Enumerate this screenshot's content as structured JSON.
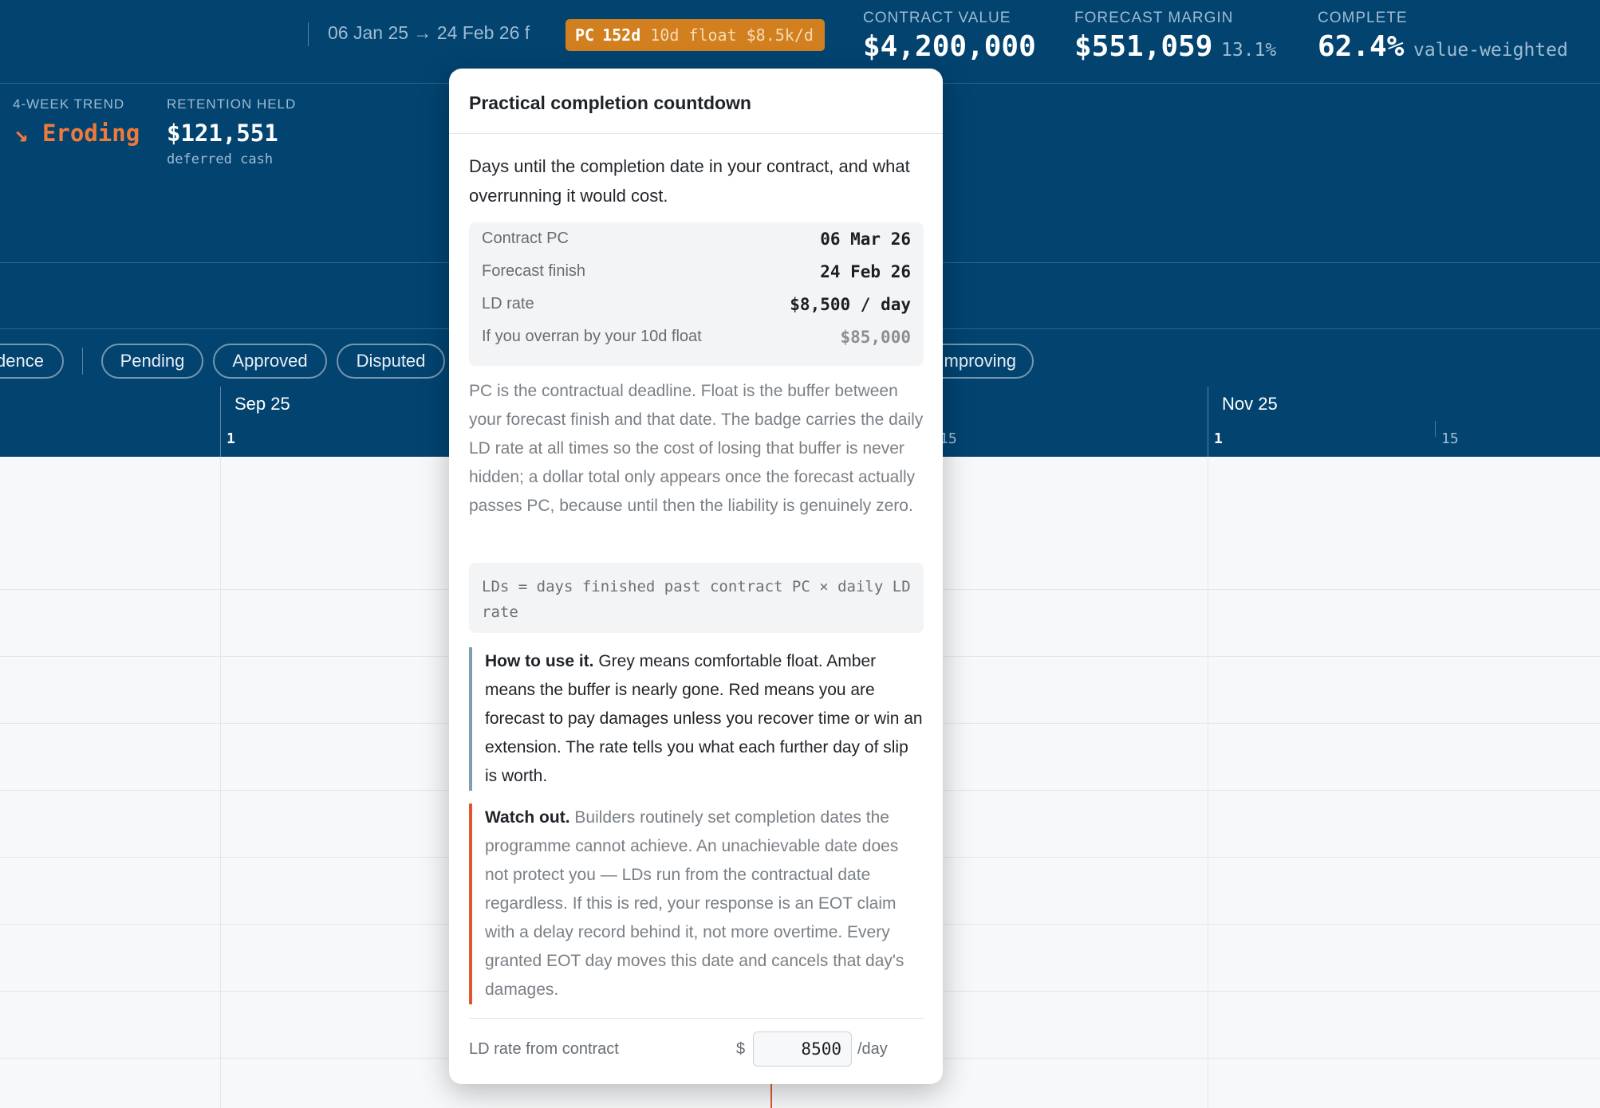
{
  "header": {
    "date_range": "06 Jan 25 → 24 Feb 26 f",
    "pc_badge": {
      "label": "PC",
      "days": "152d",
      "float": "10d float",
      "rate": "$8.5k/d"
    },
    "kpis": [
      {
        "label": "CONTRACT VALUE",
        "value": "$4,200,000",
        "sub": ""
      },
      {
        "label": "FORECAST MARGIN",
        "value": "$551,059",
        "sub": "13.1%"
      },
      {
        "label": "COMPLETE",
        "value": "62.4%",
        "sub": "value-weighted"
      }
    ],
    "trend": {
      "label": "4-WEEK TREND",
      "icon": "arrow-down-right-icon",
      "value": "Eroding"
    },
    "retention": {
      "label": "RETENTION HELD",
      "value": "$121,551",
      "sub": "deferred cash"
    },
    "filters": [
      "dence",
      "Pending",
      "Approved",
      "Disputed",
      "mproving"
    ],
    "timeline": {
      "months": [
        "Sep 25",
        "Nov 25"
      ],
      "ticks": [
        "1",
        "15",
        "1",
        "15"
      ]
    }
  },
  "popover": {
    "title": "Practical completion countdown",
    "intro": "Days until the completion date in your contract, and what overrunning it would cost.",
    "stats": [
      {
        "label": "Contract PC",
        "value": "06 Mar 26"
      },
      {
        "label": "Forecast finish",
        "value": "24 Feb 26"
      },
      {
        "label": "LD rate",
        "value": "$8,500 / day"
      },
      {
        "label": "If you overran by your 10d float",
        "value": "$85,000"
      }
    ],
    "explanation": "PC is the contractual deadline. Float is the buffer between your forecast finish and that date. The badge carries the daily LD rate at all times so the cost of losing that buffer is never hidden; a dollar total only appears once the forecast actually passes PC, because until then the liability is genuinely zero.",
    "formula": "LDs = days finished past contract PC × daily LD rate",
    "how_to": {
      "lead": "How to use it.",
      "text": " Grey means comfortable float. Amber means the buffer is nearly gone. Red means you are forecast to pay damages unless you recover time or win an extension. The rate tells you what each further day of slip is worth."
    },
    "watch_out": {
      "lead": "Watch out.",
      "text": " Builders routinely set completion dates the programme cannot achieve. An unachievable date does not protect you — LDs run from the contractual date regardless. If this is red, your response is an EOT claim with a delay record behind it, not more overtime. Every granted EOT day moves this date and cancels that day's damages."
    },
    "footer": {
      "label": "LD rate from contract",
      "currency": "$",
      "value": "8500",
      "unit": "/day"
    }
  },
  "colors": {
    "header_bg": "#024370",
    "badge_amber": "#d2801f",
    "trend_orange": "#ef7a3b",
    "watch_red": "#e0572f",
    "how_to_border": "#7ea0ae"
  }
}
